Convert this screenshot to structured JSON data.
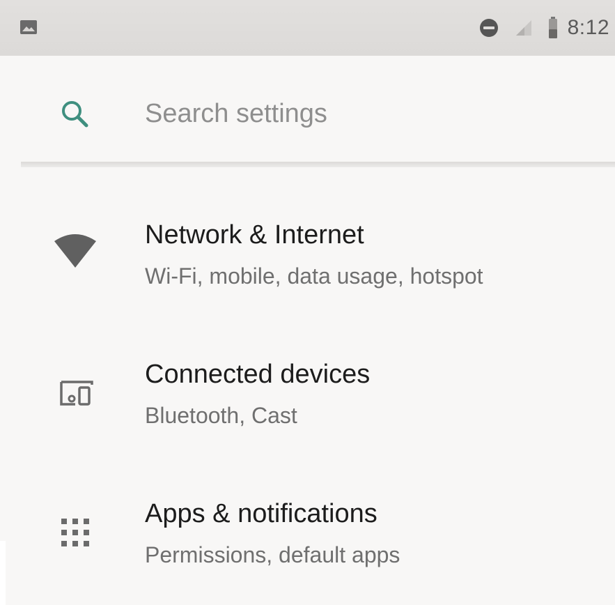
{
  "status_bar": {
    "time": "8:12",
    "icons": [
      "image-notification-icon",
      "do-not-disturb-icon",
      "signal-icon",
      "battery-icon"
    ]
  },
  "search": {
    "placeholder": "Search settings",
    "icon": "search-icon"
  },
  "settings": {
    "items": [
      {
        "icon": "wifi-icon",
        "title": "Network & Internet",
        "subtitle": "Wi-Fi, mobile, data usage, hotspot"
      },
      {
        "icon": "connected-devices-icon",
        "title": "Connected devices",
        "subtitle": "Bluetooth, Cast"
      },
      {
        "icon": "apps-grid-icon",
        "title": "Apps & notifications",
        "subtitle": "Permissions, default apps"
      }
    ]
  },
  "colors": {
    "accent": "#3f8f7f",
    "icon_gray": "#6b6b6b",
    "title_text": "#1c1c1c",
    "subtitle_text": "#6f6f6f",
    "background": "#f8f7f6",
    "status_bar": "#dedcda"
  }
}
